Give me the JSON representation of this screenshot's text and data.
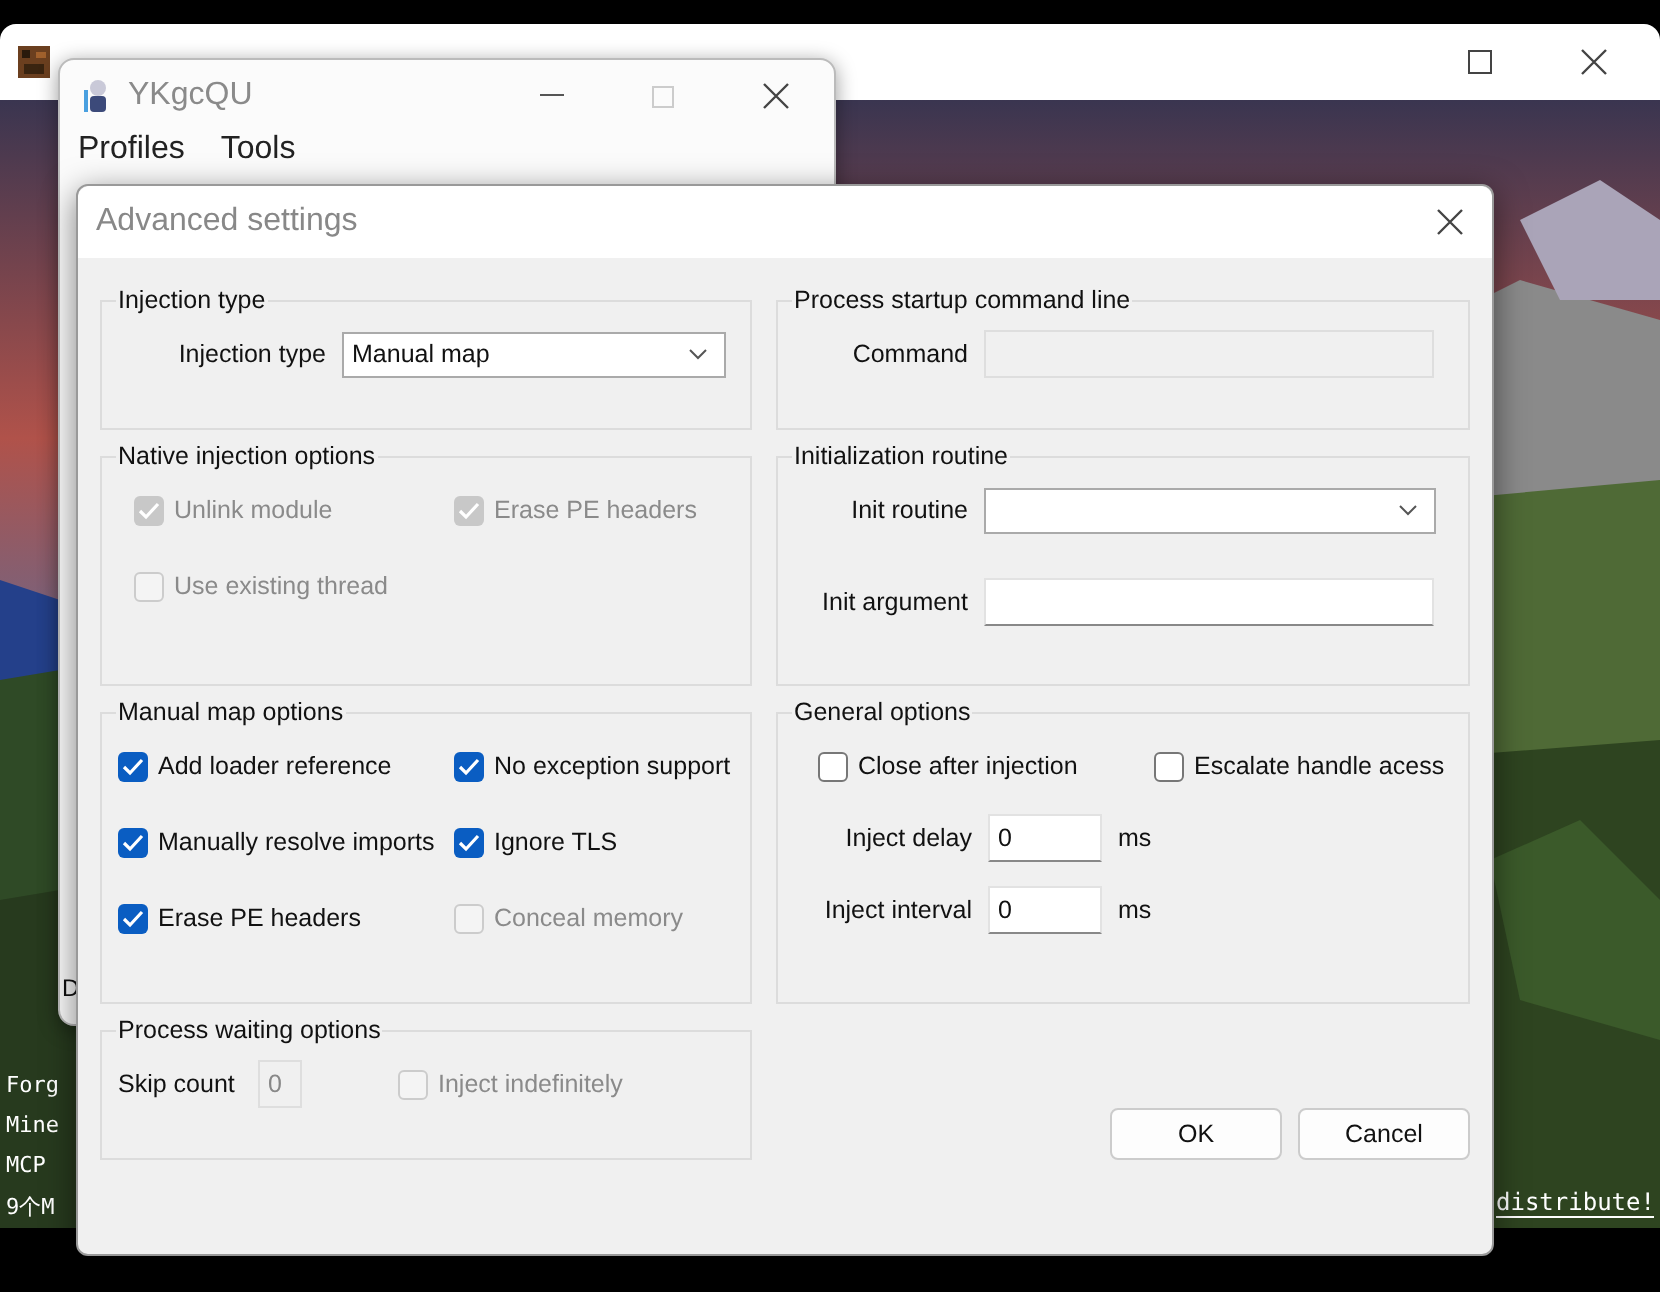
{
  "game": {
    "lines": [
      "Forg",
      "Mine",
      "MCP",
      "9个M"
    ],
    "right_text": "distribute!"
  },
  "main_window": {
    "title": "YKgcQU",
    "menu": [
      "Profiles",
      "Tools"
    ],
    "partial_text": "D"
  },
  "dialog": {
    "title": "Advanced settings",
    "columns": [
      {
        "groups": [
          {
            "title": "Injection type",
            "rows": [
              [
                {
                  "kind": "combo",
                  "label": "Injection type",
                  "value": "Manual map"
                }
              ]
            ]
          },
          {
            "title": "Native injection options",
            "rows": [
              [
                {
                  "kind": "checkbox",
                  "label": "Unlink module",
                  "checked": true,
                  "disabled": true
                },
                {
                  "kind": "checkbox",
                  "label": "Erase PE headers",
                  "checked": true,
                  "disabled": true
                }
              ],
              [
                {
                  "kind": "checkbox",
                  "label": "Use existing thread",
                  "checked": false,
                  "disabled": true
                }
              ]
            ]
          },
          {
            "title": "Manual map options",
            "rows": [
              [
                {
                  "kind": "checkbox",
                  "label": "Add loader reference",
                  "checked": true,
                  "disabled": false
                },
                {
                  "kind": "checkbox",
                  "label": "No exception support",
                  "checked": true,
                  "disabled": false
                }
              ],
              [
                {
                  "kind": "checkbox",
                  "label": "Manually resolve imports",
                  "checked": true,
                  "disabled": false
                },
                {
                  "kind": "checkbox",
                  "label": "Ignore TLS",
                  "checked": true,
                  "disabled": false
                }
              ],
              [
                {
                  "kind": "checkbox",
                  "label": "Erase PE headers",
                  "checked": true,
                  "disabled": false
                },
                {
                  "kind": "checkbox",
                  "label": "Conceal memory",
                  "checked": false,
                  "disabled": true
                }
              ]
            ]
          },
          {
            "title": "Process waiting options",
            "rows": [
              [
                {
                  "kind": "field",
                  "label": "Skip count",
                  "value": "0",
                  "disabled": true
                },
                {
                  "kind": "checkbox",
                  "label": "Inject indefinitely",
                  "checked": false,
                  "disabled": true
                }
              ]
            ]
          }
        ]
      },
      {
        "groups": [
          {
            "title": "Process startup command line",
            "rows": [
              [
                {
                  "kind": "field",
                  "label": "Command",
                  "disabled": true
                }
              ]
            ]
          },
          {
            "title": "Initialization routine",
            "rows": [
              [
                {
                  "kind": "combo",
                  "label": "Init routine"
                }
              ],
              [
                {
                  "kind": "field",
                  "label": "Init argument",
                  "disabled": false
                }
              ]
            ]
          },
          {
            "title": "General options",
            "rows": [
              [
                {
                  "kind": "checkbox",
                  "label": "Close after injection",
                  "checked": false,
                  "disabled": false
                },
                {
                  "kind": "checkbox",
                  "label": "Escalate handle acess",
                  "checked": false,
                  "disabled": false
                }
              ],
              [
                {
                  "kind": "field",
                  "label": "Inject delay",
                  "value": "0",
                  "unit": "ms",
                  "disabled": false
                }
              ],
              [
                {
                  "kind": "field",
                  "label": "Inject interval",
                  "value": "0",
                  "unit": "ms",
                  "disabled": false
                }
              ]
            ]
          }
        ]
      }
    ],
    "buttons": [
      "OK",
      "Cancel"
    ]
  }
}
